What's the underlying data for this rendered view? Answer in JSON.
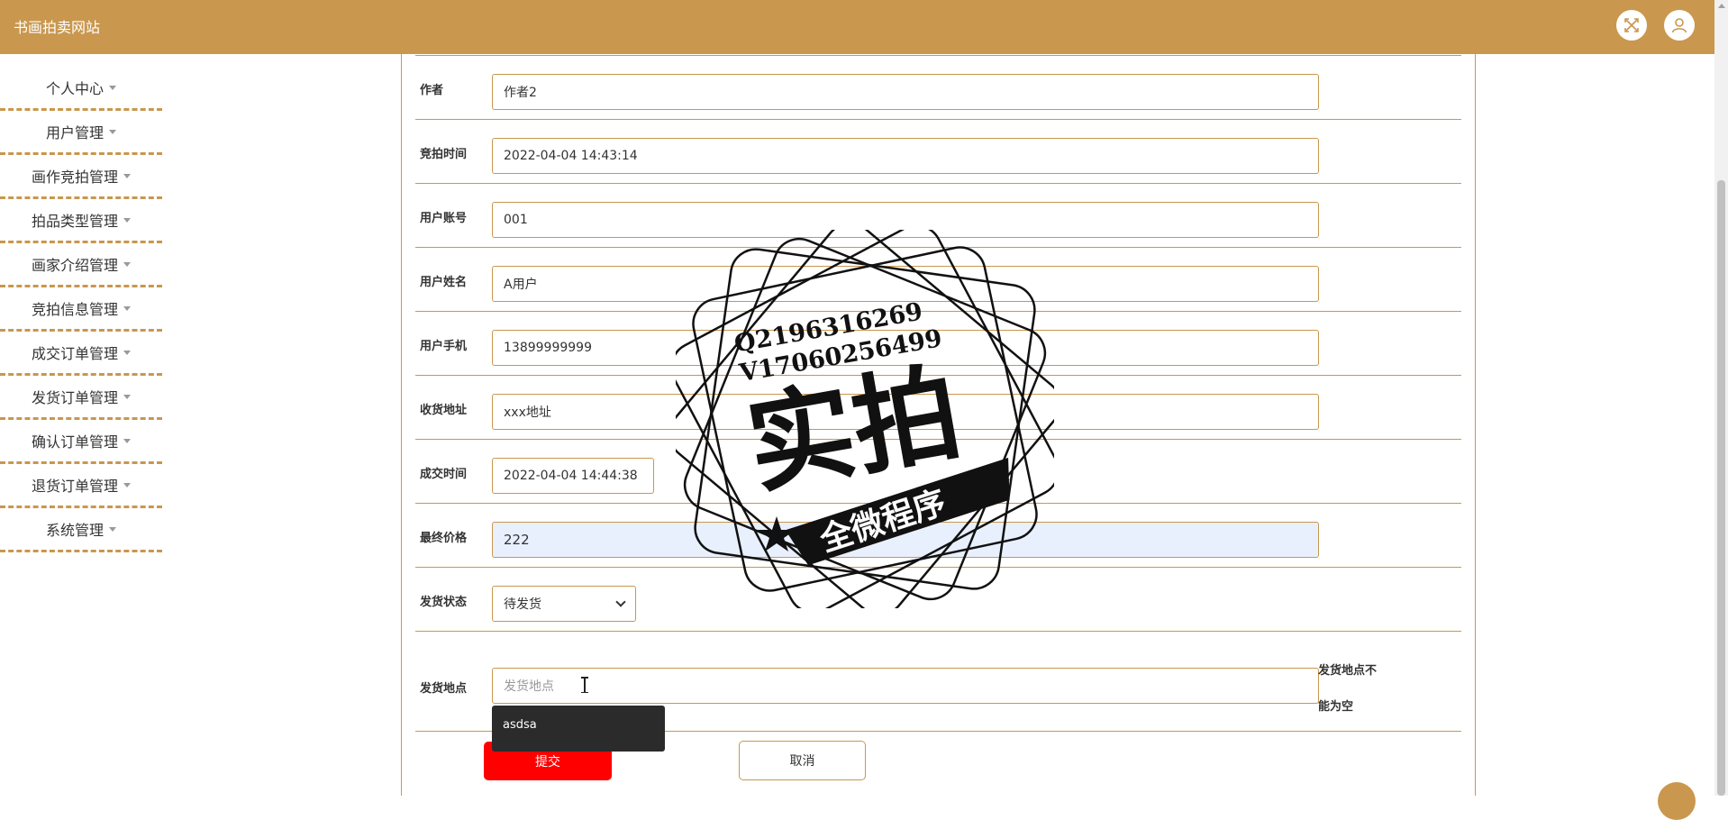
{
  "header": {
    "site_title": "书画拍卖网站"
  },
  "sidebar": {
    "items": [
      {
        "label": "个人中心"
      },
      {
        "label": "用户管理"
      },
      {
        "label": "画作竞拍管理"
      },
      {
        "label": "拍品类型管理"
      },
      {
        "label": "画家介绍管理"
      },
      {
        "label": "竞拍信息管理"
      },
      {
        "label": "成交订单管理"
      },
      {
        "label": "发货订单管理"
      },
      {
        "label": "确认订单管理"
      },
      {
        "label": "退货订单管理"
      },
      {
        "label": "系统管理"
      }
    ]
  },
  "form": {
    "author": {
      "label": "作者",
      "value": "作者2"
    },
    "auction_time": {
      "label": "竞拍时间",
      "value": "2022-04-04 14:43:14"
    },
    "user_account": {
      "label": "用户账号",
      "value": "001"
    },
    "user_name": {
      "label": "用户姓名",
      "value": "A用户"
    },
    "user_phone": {
      "label": "用户手机",
      "value": "13899999999"
    },
    "shipping_address": {
      "label": "收货地址",
      "value": "xxx地址"
    },
    "deal_time": {
      "label": "成交时间",
      "value": "2022-04-04 14:44:38"
    },
    "final_price": {
      "label": "最终价格",
      "value": "222"
    },
    "ship_status": {
      "label": "发货状态",
      "value": "待发货"
    },
    "ship_location": {
      "label": "发货地点",
      "placeholder": "发货地点",
      "error_line1": "发货地点不",
      "error_line2": "能为空"
    },
    "autocomplete_option": "asdsa",
    "submit_label": "提交",
    "cancel_label": "取消"
  },
  "watermark": {
    "qq": "Q2196316269",
    "vx": "V17060256499",
    "main": "实拍",
    "ribbon": "全微程序"
  },
  "colors": {
    "accent": "#c9974e",
    "submit": "#ff0000"
  },
  "icons": {
    "fullscreen": "fullscreen-icon",
    "user": "user-icon"
  }
}
